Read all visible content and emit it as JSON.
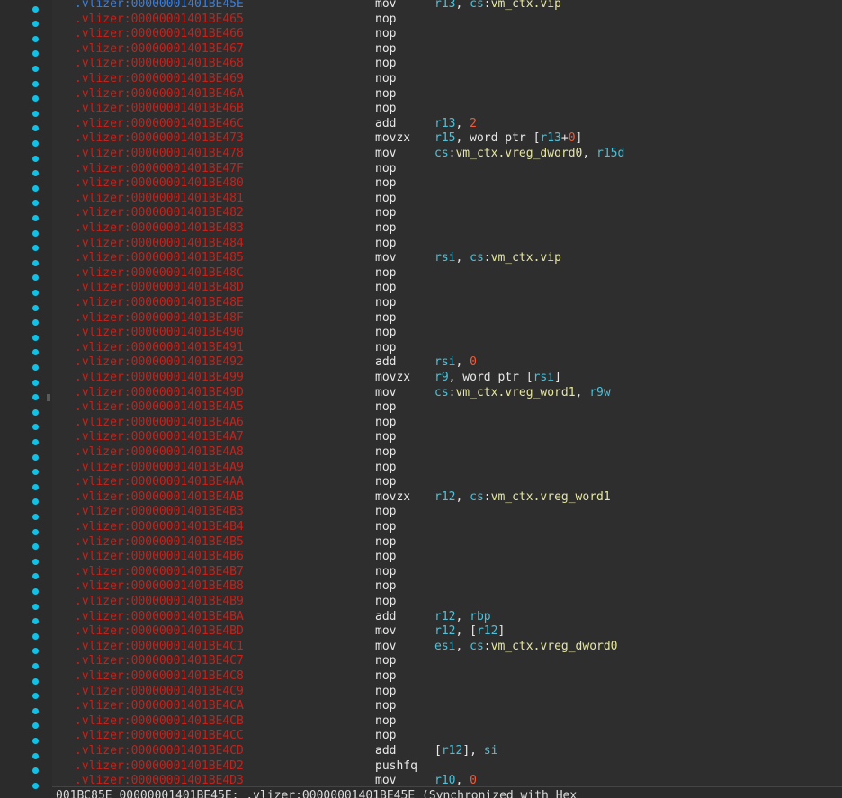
{
  "listing": [
    {
      "addr": ".vlizer:00000001401BE45E",
      "mnem": "mov",
      "ops": [
        [
          "r13",
          "reg"
        ],
        [
          ", ",
          "plain"
        ],
        [
          "cs",
          "reg"
        ],
        [
          ":",
          "plain"
        ],
        [
          "vm_ctx.vip",
          "mem"
        ]
      ],
      "current": true
    },
    {
      "addr": ".vlizer:00000001401BE465",
      "mnem": "nop",
      "ops": []
    },
    {
      "addr": ".vlizer:00000001401BE466",
      "mnem": "nop",
      "ops": []
    },
    {
      "addr": ".vlizer:00000001401BE467",
      "mnem": "nop",
      "ops": []
    },
    {
      "addr": ".vlizer:00000001401BE468",
      "mnem": "nop",
      "ops": []
    },
    {
      "addr": ".vlizer:00000001401BE469",
      "mnem": "nop",
      "ops": []
    },
    {
      "addr": ".vlizer:00000001401BE46A",
      "mnem": "nop",
      "ops": []
    },
    {
      "addr": ".vlizer:00000001401BE46B",
      "mnem": "nop",
      "ops": []
    },
    {
      "addr": ".vlizer:00000001401BE46C",
      "mnem": "add",
      "ops": [
        [
          "r13",
          "reg"
        ],
        [
          ", ",
          "plain"
        ],
        [
          "2",
          "num"
        ]
      ]
    },
    {
      "addr": ".vlizer:00000001401BE473",
      "mnem": "movzx",
      "ops": [
        [
          "r15",
          "reg"
        ],
        [
          ", word ptr [",
          "plain"
        ],
        [
          "r13",
          "reg"
        ],
        [
          "+",
          "plain"
        ],
        [
          "0",
          "num"
        ],
        [
          "]",
          "plain"
        ]
      ]
    },
    {
      "addr": ".vlizer:00000001401BE478",
      "mnem": "mov",
      "ops": [
        [
          "cs",
          "reg"
        ],
        [
          ":",
          "plain"
        ],
        [
          "vm_ctx.vreg_dword0",
          "mem"
        ],
        [
          ", ",
          "plain"
        ],
        [
          "r15d",
          "reg"
        ]
      ]
    },
    {
      "addr": ".vlizer:00000001401BE47F",
      "mnem": "nop",
      "ops": []
    },
    {
      "addr": ".vlizer:00000001401BE480",
      "mnem": "nop",
      "ops": []
    },
    {
      "addr": ".vlizer:00000001401BE481",
      "mnem": "nop",
      "ops": []
    },
    {
      "addr": ".vlizer:00000001401BE482",
      "mnem": "nop",
      "ops": []
    },
    {
      "addr": ".vlizer:00000001401BE483",
      "mnem": "nop",
      "ops": []
    },
    {
      "addr": ".vlizer:00000001401BE484",
      "mnem": "nop",
      "ops": []
    },
    {
      "addr": ".vlizer:00000001401BE485",
      "mnem": "mov",
      "ops": [
        [
          "rsi",
          "reg"
        ],
        [
          ", ",
          "plain"
        ],
        [
          "cs",
          "reg"
        ],
        [
          ":",
          "plain"
        ],
        [
          "vm_ctx.vip",
          "mem"
        ]
      ]
    },
    {
      "addr": ".vlizer:00000001401BE48C",
      "mnem": "nop",
      "ops": []
    },
    {
      "addr": ".vlizer:00000001401BE48D",
      "mnem": "nop",
      "ops": []
    },
    {
      "addr": ".vlizer:00000001401BE48E",
      "mnem": "nop",
      "ops": []
    },
    {
      "addr": ".vlizer:00000001401BE48F",
      "mnem": "nop",
      "ops": []
    },
    {
      "addr": ".vlizer:00000001401BE490",
      "mnem": "nop",
      "ops": []
    },
    {
      "addr": ".vlizer:00000001401BE491",
      "mnem": "nop",
      "ops": []
    },
    {
      "addr": ".vlizer:00000001401BE492",
      "mnem": "add",
      "ops": [
        [
          "rsi",
          "reg"
        ],
        [
          ", ",
          "plain"
        ],
        [
          "0",
          "num"
        ]
      ]
    },
    {
      "addr": ".vlizer:00000001401BE499",
      "mnem": "movzx",
      "ops": [
        [
          "r9",
          "reg"
        ],
        [
          ", word ptr [",
          "plain"
        ],
        [
          "rsi",
          "reg"
        ],
        [
          "]",
          "plain"
        ]
      ]
    },
    {
      "addr": ".vlizer:00000001401BE49D",
      "mnem": "mov",
      "ops": [
        [
          "cs",
          "reg"
        ],
        [
          ":",
          "plain"
        ],
        [
          "vm_ctx.vreg_word1",
          "mem"
        ],
        [
          ", ",
          "plain"
        ],
        [
          "r9w",
          "reg"
        ]
      ]
    },
    {
      "addr": ".vlizer:00000001401BE4A5",
      "mnem": "nop",
      "ops": []
    },
    {
      "addr": ".vlizer:00000001401BE4A6",
      "mnem": "nop",
      "ops": []
    },
    {
      "addr": ".vlizer:00000001401BE4A7",
      "mnem": "nop",
      "ops": []
    },
    {
      "addr": ".vlizer:00000001401BE4A8",
      "mnem": "nop",
      "ops": []
    },
    {
      "addr": ".vlizer:00000001401BE4A9",
      "mnem": "nop",
      "ops": []
    },
    {
      "addr": ".vlizer:00000001401BE4AA",
      "mnem": "nop",
      "ops": []
    },
    {
      "addr": ".vlizer:00000001401BE4AB",
      "mnem": "movzx",
      "ops": [
        [
          "r12",
          "reg"
        ],
        [
          ", ",
          "plain"
        ],
        [
          "cs",
          "reg"
        ],
        [
          ":",
          "plain"
        ],
        [
          "vm_ctx.vreg_word1",
          "mem"
        ]
      ]
    },
    {
      "addr": ".vlizer:00000001401BE4B3",
      "mnem": "nop",
      "ops": []
    },
    {
      "addr": ".vlizer:00000001401BE4B4",
      "mnem": "nop",
      "ops": []
    },
    {
      "addr": ".vlizer:00000001401BE4B5",
      "mnem": "nop",
      "ops": []
    },
    {
      "addr": ".vlizer:00000001401BE4B6",
      "mnem": "nop",
      "ops": []
    },
    {
      "addr": ".vlizer:00000001401BE4B7",
      "mnem": "nop",
      "ops": []
    },
    {
      "addr": ".vlizer:00000001401BE4B8",
      "mnem": "nop",
      "ops": []
    },
    {
      "addr": ".vlizer:00000001401BE4B9",
      "mnem": "nop",
      "ops": []
    },
    {
      "addr": ".vlizer:00000001401BE4BA",
      "mnem": "add",
      "ops": [
        [
          "r12",
          "reg"
        ],
        [
          ", ",
          "plain"
        ],
        [
          "rbp",
          "reg"
        ]
      ]
    },
    {
      "addr": ".vlizer:00000001401BE4BD",
      "mnem": "mov",
      "ops": [
        [
          "r12",
          "reg"
        ],
        [
          ", [",
          "plain"
        ],
        [
          "r12",
          "reg"
        ],
        [
          "]",
          "plain"
        ]
      ]
    },
    {
      "addr": ".vlizer:00000001401BE4C1",
      "mnem": "mov",
      "ops": [
        [
          "esi",
          "reg"
        ],
        [
          ", ",
          "plain"
        ],
        [
          "cs",
          "reg"
        ],
        [
          ":",
          "plain"
        ],
        [
          "vm_ctx.vreg_dword0",
          "mem"
        ]
      ]
    },
    {
      "addr": ".vlizer:00000001401BE4C7",
      "mnem": "nop",
      "ops": []
    },
    {
      "addr": ".vlizer:00000001401BE4C8",
      "mnem": "nop",
      "ops": []
    },
    {
      "addr": ".vlizer:00000001401BE4C9",
      "mnem": "nop",
      "ops": []
    },
    {
      "addr": ".vlizer:00000001401BE4CA",
      "mnem": "nop",
      "ops": []
    },
    {
      "addr": ".vlizer:00000001401BE4CB",
      "mnem": "nop",
      "ops": []
    },
    {
      "addr": ".vlizer:00000001401BE4CC",
      "mnem": "nop",
      "ops": []
    },
    {
      "addr": ".vlizer:00000001401BE4CD",
      "mnem": "add",
      "ops": [
        [
          "[",
          "plain"
        ],
        [
          "r12",
          "reg"
        ],
        [
          "], ",
          "plain"
        ],
        [
          "si",
          "reg"
        ]
      ]
    },
    {
      "addr": ".vlizer:00000001401BE4D2",
      "mnem": "pushfq",
      "ops": []
    },
    {
      "addr": ".vlizer:00000001401BE4D3",
      "mnem": "mov",
      "ops": [
        [
          "r10",
          "reg"
        ],
        [
          ", ",
          "plain"
        ],
        [
          "0",
          "num"
        ]
      ]
    }
  ],
  "status_bar": {
    "text": "001BC85E 00000001401BE45E: .vlizer:00000001401BE45E (Synchronized with Hex"
  },
  "colors": {
    "address": "#c4221c",
    "current_address": "#3a7fe0",
    "register": "#4ec0d8",
    "number": "#f05a3a",
    "memory": "#e6e6a0",
    "breakpoint_dot": "#11c2e8"
  }
}
